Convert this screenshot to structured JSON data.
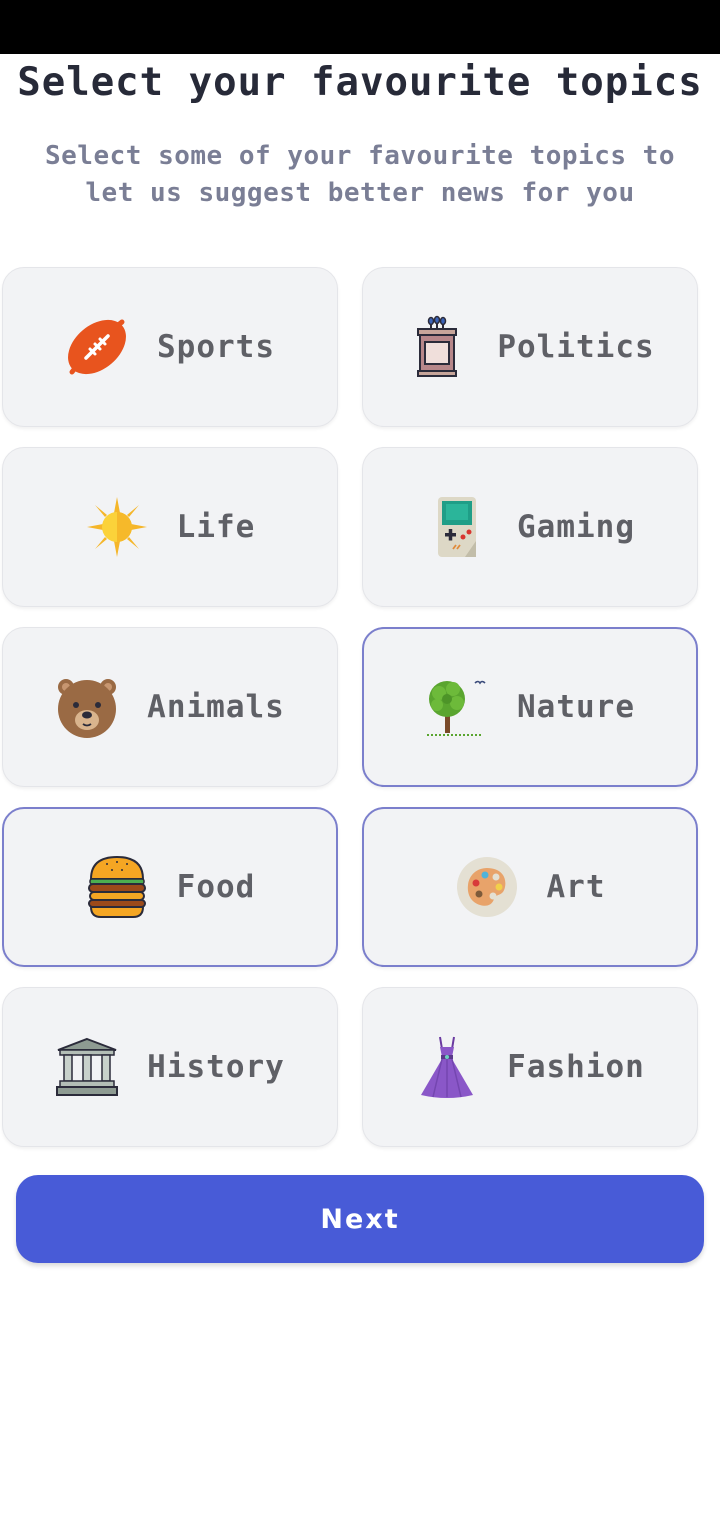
{
  "header": {
    "title": "Select your favourite topics",
    "subtitle_line1": "Select some of your favourite topics to",
    "subtitle_line2": "let us suggest better news for you"
  },
  "topics": [
    {
      "label": "Sports",
      "icon": "football-icon",
      "selected": false
    },
    {
      "label": "Politics",
      "icon": "podium-icon",
      "selected": false
    },
    {
      "label": "Life",
      "icon": "sun-icon",
      "selected": false
    },
    {
      "label": "Gaming",
      "icon": "gameboy-icon",
      "selected": false
    },
    {
      "label": "Animals",
      "icon": "bear-icon",
      "selected": false
    },
    {
      "label": "Nature",
      "icon": "tree-icon",
      "selected": true
    },
    {
      "label": "Food",
      "icon": "burger-icon",
      "selected": true
    },
    {
      "label": "Art",
      "icon": "palette-icon",
      "selected": true
    },
    {
      "label": "History",
      "icon": "museum-icon",
      "selected": false
    },
    {
      "label": "Fashion",
      "icon": "dress-icon",
      "selected": false
    }
  ],
  "next_button": {
    "label": "Next"
  },
  "colors": {
    "accent": "#485bd7",
    "selected_border": "#7b7fcc",
    "card_bg": "#f2f3f5",
    "title": "#272a38",
    "subtitle": "#7a7e95"
  }
}
